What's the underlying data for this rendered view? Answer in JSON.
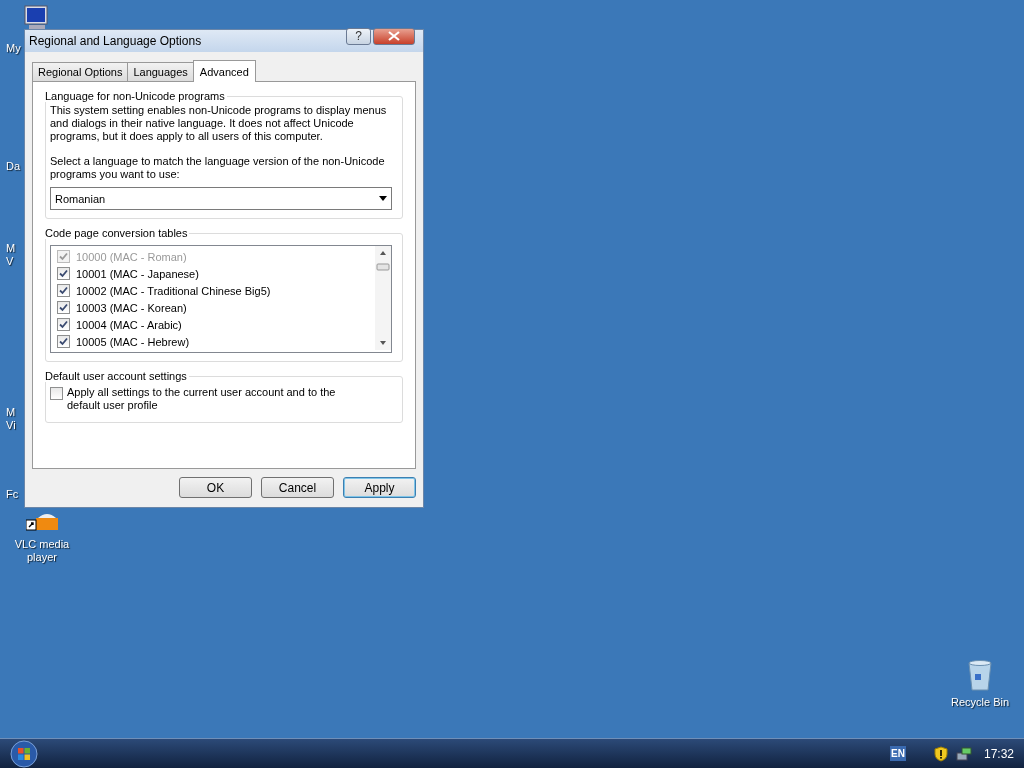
{
  "desktop_icons": [
    {
      "kind": "computer",
      "lines": [
        "My"
      ]
    },
    {
      "kind": "none",
      "lines": [
        "Da"
      ]
    },
    {
      "kind": "none",
      "lines": [
        "M",
        "V"
      ]
    },
    {
      "kind": "none",
      "lines": [
        "M",
        "Vi"
      ]
    },
    {
      "kind": "none",
      "lines": [
        "Fc"
      ]
    },
    {
      "kind": "vlc",
      "lines": [
        "VLC media",
        "player"
      ]
    },
    {
      "kind": "recycle",
      "lines": [
        "Recycle Bin"
      ]
    }
  ],
  "window": {
    "title": "Regional and Language Options",
    "help": "?"
  },
  "tabs": [
    {
      "label": "Regional Options",
      "selected": false
    },
    {
      "label": "Languages",
      "selected": false
    },
    {
      "label": "Advanced",
      "selected": true
    }
  ],
  "non_unicode_group": {
    "title": "Language for non-Unicode programs",
    "description": "This system setting enables non-Unicode programs to display menus and dialogs in their native language. It does not affect Unicode programs, but it does apply to all users of this computer.",
    "prompt": "Select a language to match the language version of the non-Unicode programs you want to use:",
    "language": "Romanian"
  },
  "code_page_group": {
    "title": "Code page conversion tables",
    "items": [
      {
        "label": "10000 (MAC - Roman)",
        "checked": true,
        "disabled": true
      },
      {
        "label": "10001 (MAC - Japanese)",
        "checked": true,
        "disabled": false
      },
      {
        "label": "10002 (MAC - Traditional Chinese Big5)",
        "checked": true,
        "disabled": false
      },
      {
        "label": "10003 (MAC - Korean)",
        "checked": true,
        "disabled": false
      },
      {
        "label": "10004 (MAC - Arabic)",
        "checked": true,
        "disabled": false
      },
      {
        "label": "10005 (MAC - Hebrew)",
        "checked": true,
        "disabled": false
      }
    ]
  },
  "default_account_group": {
    "title": "Default user account settings",
    "option": {
      "label": "Apply all settings to the current user account and to the default user profile",
      "checked": false
    }
  },
  "buttons": [
    {
      "label": "OK",
      "default": false
    },
    {
      "label": "Cancel",
      "default": false
    },
    {
      "label": "Apply",
      "default": true
    }
  ],
  "taskbar": {
    "language": "EN",
    "clock": "17:32"
  }
}
